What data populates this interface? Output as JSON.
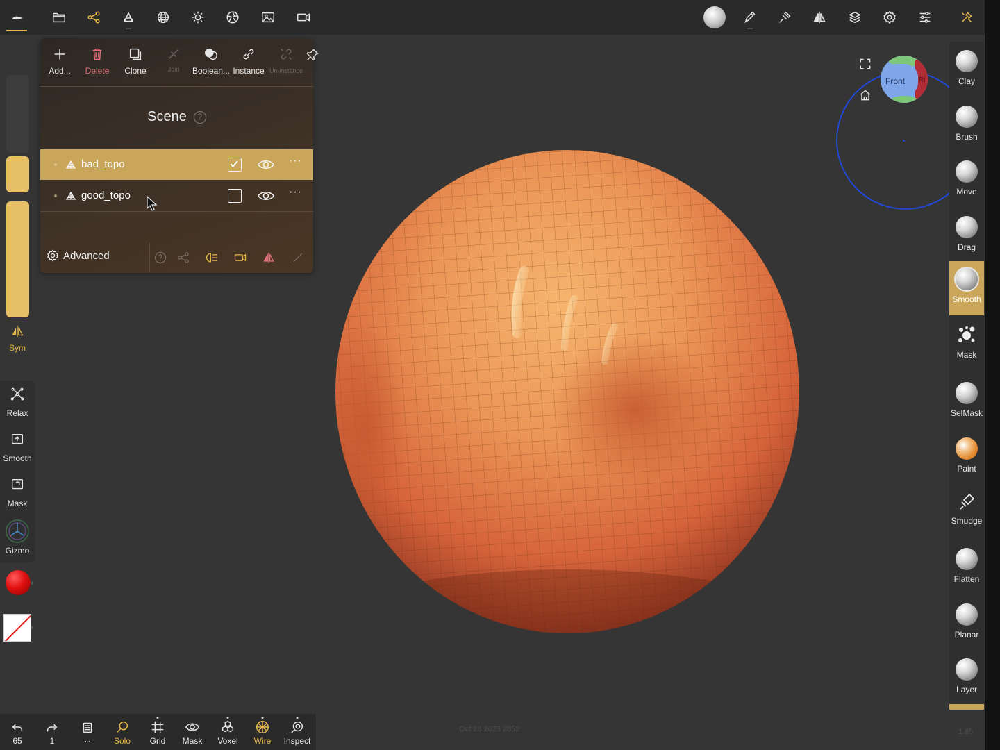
{
  "top_toolbar": {
    "left_icons": [
      "logo-icon",
      "folder-icon",
      "share-nodes-icon",
      "shapes-icon",
      "sphere-grid-icon",
      "sun-icon",
      "aperture-icon",
      "image-icon",
      "video-icon"
    ],
    "right_icons": [
      "brush-preview-icon",
      "pen-icon",
      "stroke-icon",
      "symmetry-icon",
      "layers-icon",
      "settings-icon",
      "sliders-icon",
      "tools-icon"
    ]
  },
  "left_toolbar": {
    "sym_label": "Sym",
    "tools": [
      {
        "label": "Relax",
        "icon": "relax-icon"
      },
      {
        "label": "Smooth",
        "icon": "smooth-box-icon"
      },
      {
        "label": "Mask",
        "icon": "mask-box-icon"
      },
      {
        "label": "Gizmo",
        "icon": "gizmo-icon"
      }
    ],
    "slider_color": "#e6bf66",
    "color_swatch": "#e01010"
  },
  "scene_panel": {
    "toolbar": [
      {
        "label": "Add...",
        "icon": "plus-icon",
        "state": "normal"
      },
      {
        "label": "Delete",
        "icon": "trash-icon",
        "state": "danger"
      },
      {
        "label": "Clone",
        "icon": "clone-icon",
        "state": "normal"
      },
      {
        "label": "Join",
        "icon": "join-icon",
        "state": "disabled"
      },
      {
        "label": "Boolean...",
        "icon": "boolean-icon",
        "state": "normal"
      },
      {
        "label": "Instance",
        "icon": "link-icon",
        "state": "normal"
      },
      {
        "label": "Un-instance",
        "icon": "unlink-icon",
        "state": "disabled"
      }
    ],
    "title": "Scene",
    "help_glyph": "?",
    "meshes": [
      {
        "name": "bad_topo",
        "checked": true,
        "visible": true,
        "selected": true
      },
      {
        "name": "good_topo",
        "checked": false,
        "visible": true,
        "selected": false
      }
    ],
    "more_glyph": "···",
    "advanced_label": "Advanced",
    "accent": "#c9a65a"
  },
  "viewport": {
    "timestamp": "Oct 28 2023 2852",
    "version": "1.85",
    "orientation": {
      "front": "Front",
      "right": "Ri"
    }
  },
  "right_brushes": [
    {
      "label": "Clay",
      "active": false
    },
    {
      "label": "Brush",
      "active": false
    },
    {
      "label": "Move",
      "active": false
    },
    {
      "label": "Drag",
      "active": false
    },
    {
      "label": "Smooth",
      "active": true
    },
    {
      "label": "Mask",
      "active": false
    },
    {
      "label": "SelMask",
      "active": false
    },
    {
      "label": "Paint",
      "active": false
    },
    {
      "label": "Smudge",
      "active": false
    },
    {
      "label": "Flatten",
      "active": false
    },
    {
      "label": "Planar",
      "active": false
    },
    {
      "label": "Layer",
      "active": false
    }
  ],
  "bottom_toolbar": [
    {
      "label": "65",
      "icon": "undo-icon",
      "active": false
    },
    {
      "label": "1",
      "icon": "redo-icon",
      "active": false
    },
    {
      "label": "...",
      "icon": "history-icon",
      "active": false
    },
    {
      "label": "Solo",
      "icon": "search-icon",
      "active": true
    },
    {
      "label": "Grid",
      "icon": "grid-icon",
      "active": false
    },
    {
      "label": "Mask",
      "icon": "eye-icon",
      "active": false
    },
    {
      "label": "Voxel",
      "icon": "voxel-icon",
      "active": false
    },
    {
      "label": "Wire",
      "icon": "wire-icon",
      "active": true
    },
    {
      "label": "Inspect",
      "icon": "inspect-icon",
      "active": false
    }
  ]
}
